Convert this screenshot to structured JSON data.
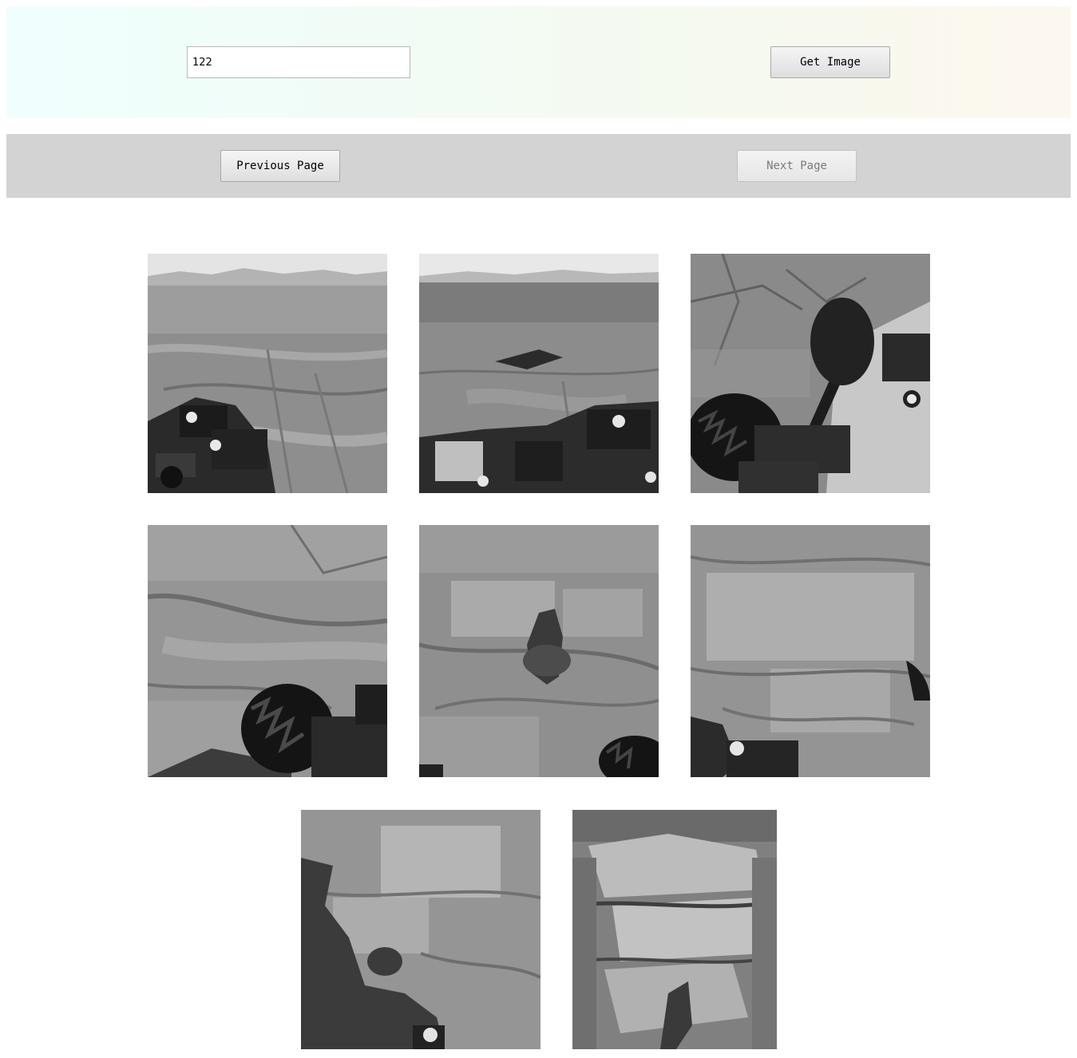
{
  "search": {
    "sol_value": "122",
    "get_image_label": "Get Image"
  },
  "pagination": {
    "previous_label": "Previous Page",
    "next_label": "Next Page",
    "next_enabled": false
  },
  "photos": [
    {
      "scene": "horizon-rover-left"
    },
    {
      "scene": "horizon-rover-right"
    },
    {
      "scene": "rover-arm-wheel"
    },
    {
      "scene": "ground-wheel"
    },
    {
      "scene": "ground-rock"
    },
    {
      "scene": "ground-bright"
    },
    {
      "scene": "ground-shadow"
    },
    {
      "scene": "ground-bright-rock"
    }
  ],
  "colors": {
    "pager_bar": "#d3d3d3",
    "top_bar_gradient": [
      "#f0fffe",
      "#fdf8ef"
    ]
  }
}
